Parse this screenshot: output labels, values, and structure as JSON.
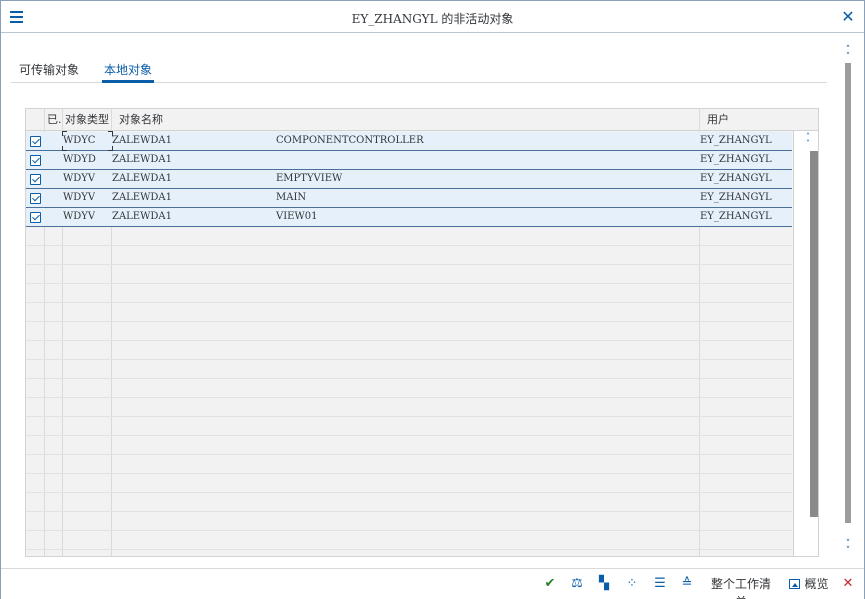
{
  "window": {
    "title": "EY_ZHANGYL 的非活动对象"
  },
  "tabs": [
    {
      "label": "可传输对象",
      "selected": false
    },
    {
      "label": "本地对象",
      "selected": true
    }
  ],
  "grid": {
    "columns": {
      "activated": "已.",
      "object_type": "对象类型",
      "object_name": "对象名称",
      "user": "用户"
    },
    "rows": [
      {
        "checked": true,
        "object_type": "WDYC",
        "component": "ZALEWDA1",
        "sub_object": "COMPONENTCONTROLLER",
        "user": "EY_ZHANGYL"
      },
      {
        "checked": true,
        "object_type": "WDYD",
        "component": "ZALEWDA1",
        "sub_object": "",
        "user": "EY_ZHANGYL"
      },
      {
        "checked": true,
        "object_type": "WDYV",
        "component": "ZALEWDA1",
        "sub_object": "EMPTYVIEW",
        "user": "EY_ZHANGYL"
      },
      {
        "checked": true,
        "object_type": "WDYV",
        "component": "ZALEWDA1",
        "sub_object": "MAIN",
        "user": "EY_ZHANGYL"
      },
      {
        "checked": true,
        "object_type": "WDYV",
        "component": "ZALEWDA1",
        "sub_object": "VIEW01",
        "user": "EY_ZHANGYL"
      }
    ]
  },
  "footer": {
    "worklist_label": "整个工作清单",
    "overview_label": "概览"
  },
  "icons": {
    "menu": "hamburger-icon",
    "close": "close-icon",
    "continue": "checkmark-icon",
    "compare": "compare-icon",
    "select_all": "select-all-icon",
    "deselect_all": "deselect-all-icon",
    "filter": "filter-icon",
    "sort": "sort-icon",
    "overview": "image-icon",
    "cancel": "cancel-icon"
  },
  "colors": {
    "accent": "#0a5da8",
    "selected_row": "#e5f0fa",
    "confirm": "#2b7d2b",
    "cancel": "#c4262e"
  }
}
